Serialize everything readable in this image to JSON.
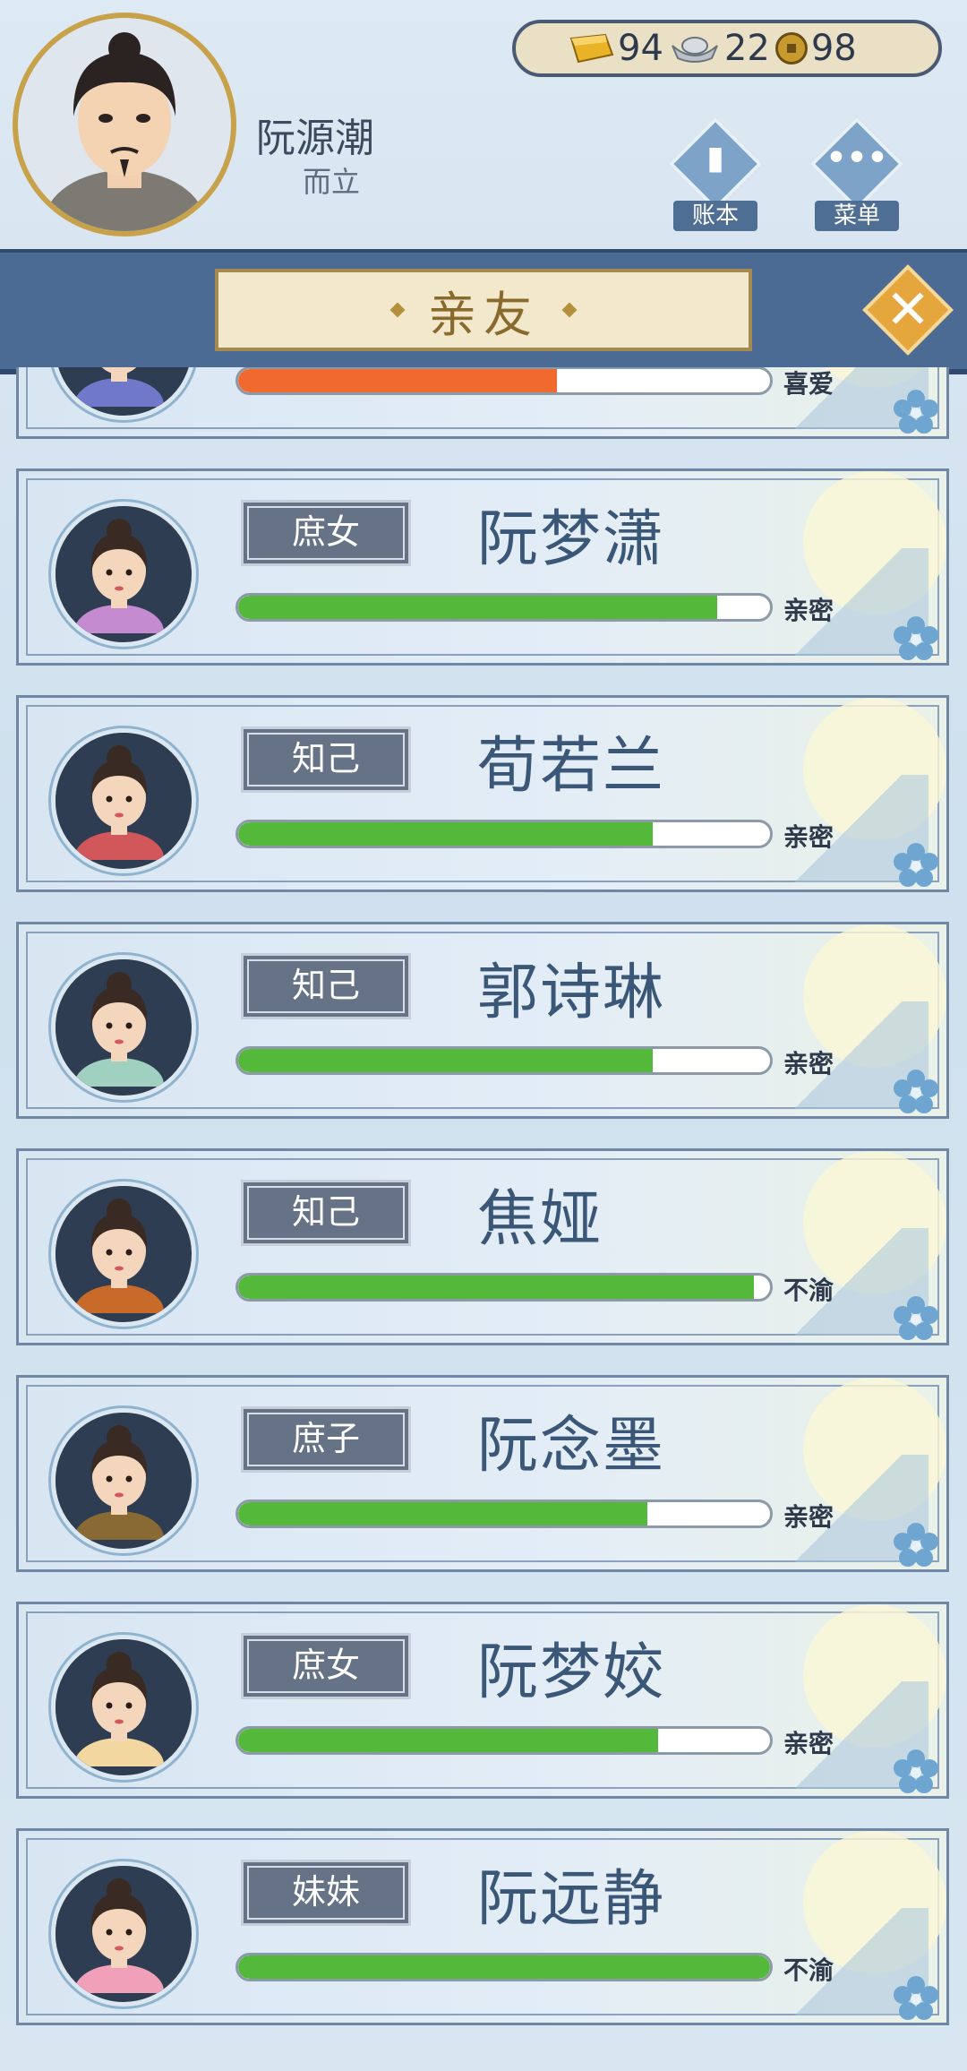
{
  "player": {
    "name": "阮源潮",
    "title": "而立"
  },
  "currency": {
    "gold": "94",
    "silver": "22",
    "coin": "98"
  },
  "header_buttons": {
    "ledger_label": "账本",
    "menu_label": "菜单"
  },
  "panel": {
    "title": "亲友"
  },
  "colors": {
    "bar_green": "#54b83a",
    "bar_orange": "#f06a30",
    "frame_blue": "#4c6b94"
  },
  "relatives": [
    {
      "relation": "",
      "name": "",
      "status": "喜爱",
      "affection": 0.6,
      "bar_color": "#f06a30"
    },
    {
      "relation": "庶女",
      "name": "阮梦潇",
      "status": "亲密",
      "affection": 0.9,
      "bar_color": "#54b83a"
    },
    {
      "relation": "知己",
      "name": "荀若兰",
      "status": "亲密",
      "affection": 0.78,
      "bar_color": "#54b83a"
    },
    {
      "relation": "知己",
      "name": "郭诗琳",
      "status": "亲密",
      "affection": 0.78,
      "bar_color": "#54b83a"
    },
    {
      "relation": "知己",
      "name": "焦娅",
      "status": "不渝",
      "affection": 0.97,
      "bar_color": "#54b83a"
    },
    {
      "relation": "庶子",
      "name": "阮念墨",
      "status": "亲密",
      "affection": 0.77,
      "bar_color": "#54b83a"
    },
    {
      "relation": "庶女",
      "name": "阮梦姣",
      "status": "亲密",
      "affection": 0.79,
      "bar_color": "#54b83a"
    },
    {
      "relation": "妹妹",
      "name": "阮远静",
      "status": "不渝",
      "affection": 1.0,
      "bar_color": "#54b83a"
    }
  ]
}
